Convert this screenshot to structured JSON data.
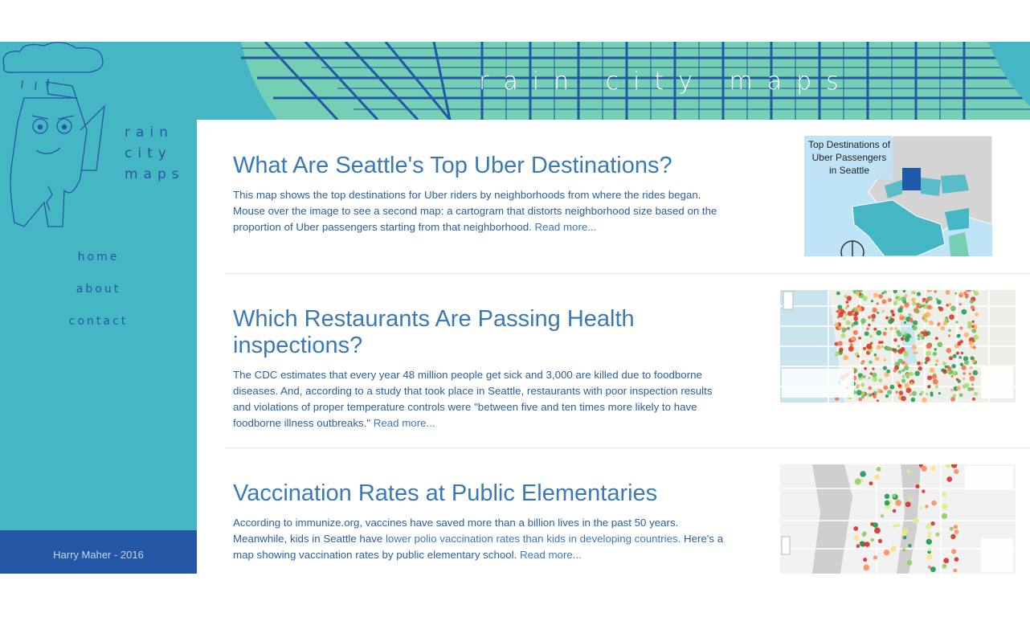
{
  "site": {
    "banner_title": "rain city maps",
    "logo_lines": [
      "rain",
      "city",
      "maps"
    ]
  },
  "nav": {
    "items": [
      {
        "label": "home"
      },
      {
        "label": "about"
      },
      {
        "label": "contact"
      }
    ]
  },
  "footer": {
    "text": "Harry Maher - 2016"
  },
  "posts": [
    {
      "title": "What Are Seattle's Top Uber Destinations?",
      "text": "This map shows the top destinations for Uber riders by neighborhoods from where the rides began. Mouse over the image to see a second map: a cartogram that distorts neighborhood size based on the proportion of Uber passengers starting from that neighborhood.",
      "read_more": "Read more...",
      "thumb_title": "Top Destinations of Uber Passengers in Seattle",
      "thumb_title_lines": [
        "Top Destinations of",
        "Uber Passengers",
        "in Seattle"
      ]
    },
    {
      "title": "Which Restaurants Are Passing Health inspections?",
      "text": "The CDC estimates that every year 48 million people get sick and 3,000 are killed due to foodborne diseases. And, according to a study that took place in Seattle, restaurants with poor inspection results and violations of proper temperature controls were \"between five and ten times more likely to have foodborne illness outbreaks.\"",
      "read_more": "Read more..."
    },
    {
      "title": "Vaccination Rates at Public Elementaries",
      "text_before": "According to immunize.org, vaccines have saved more than a billion lives in the past 50 years. Meanwhile, kids in Seattle have ",
      "link_text": "lower polio vaccination rates than kids in developing countries.",
      "text_after": " Here's a map showing vaccination rates by public elementary school.",
      "read_more": "Read more..."
    }
  ],
  "colors": {
    "sidebar": "#45b6c3",
    "footer": "#2557a7",
    "link": "#3a79b6",
    "text": "#2c5f9a"
  }
}
